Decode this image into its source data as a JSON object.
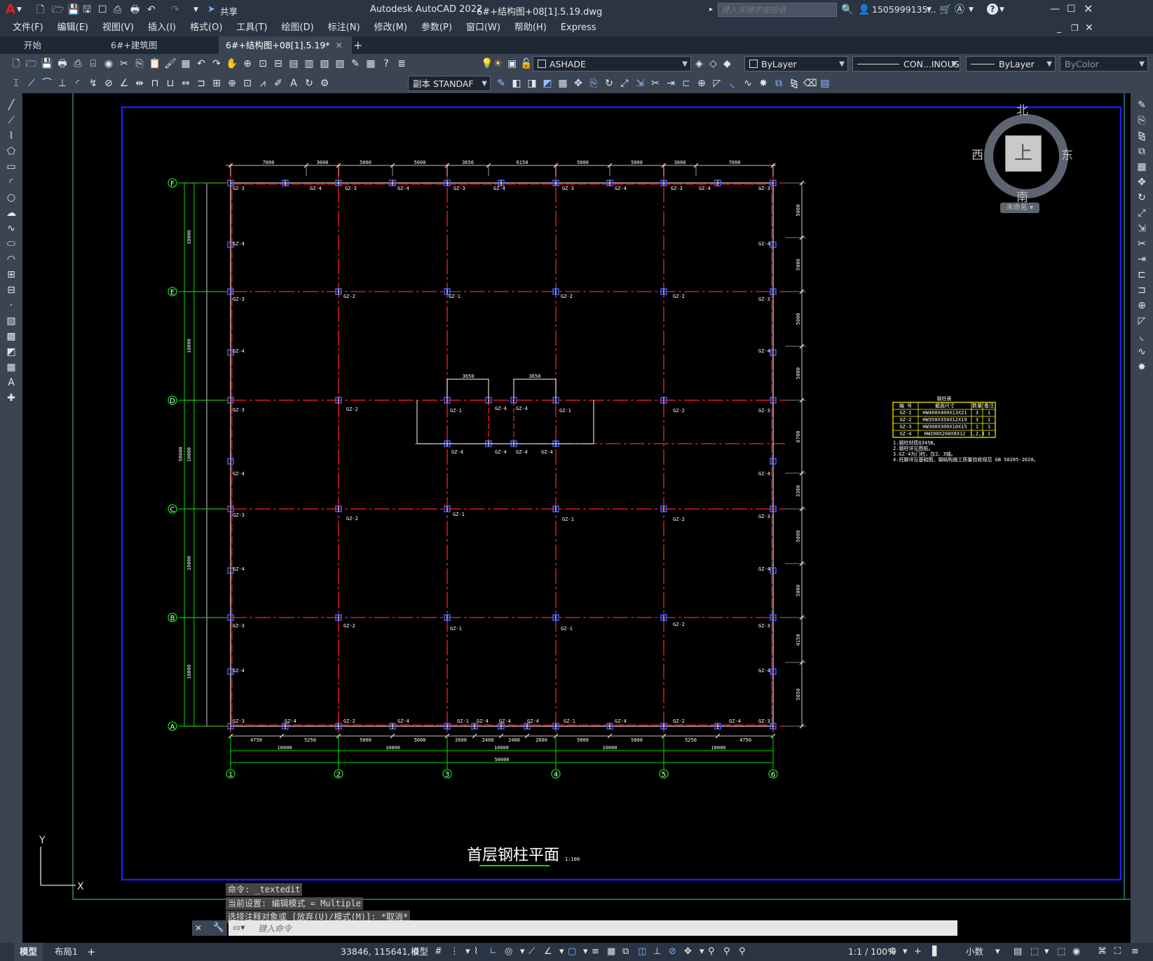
{
  "titlebar": {
    "logo": "A",
    "share_label": "共享",
    "app_title": "Autodesk AutoCAD 2022",
    "file_title": "6#+结构图+08[1].5.19.dwg",
    "search_placeholder": "键入关键字或短语",
    "user_label": "1505999135...",
    "help_label": "?"
  },
  "menu": [
    "文件(F)",
    "编辑(E)",
    "视图(V)",
    "插入(I)",
    "格式(O)",
    "工具(T)",
    "绘图(D)",
    "标注(N)",
    "修改(M)",
    "参数(P)",
    "窗口(W)",
    "帮助(H)",
    "Express"
  ],
  "tabs": [
    {
      "label": "开始"
    },
    {
      "label": "6#+建筑图+08[1].5.16"
    },
    {
      "label": "6#+结构图+08[1].5.19*"
    }
  ],
  "toolbar": {
    "layer_name": "ASHADE",
    "color": "ByLayer",
    "linetype": "CON...INOUS",
    "lineweight": "ByLayer",
    "plotstyle": "ByColor",
    "textstyle": "副本 STANDAF"
  },
  "viewcube": {
    "north": "北",
    "south": "南",
    "east": "东",
    "west": "西",
    "face": "上",
    "wcs": "未命名"
  },
  "drawing": {
    "title": "首层钢柱平面",
    "title_scale": "1:100",
    "row_labels": [
      "F",
      "E",
      "D",
      "C",
      "B",
      "A"
    ],
    "col_labels": [
      "1",
      "2",
      "3",
      "4",
      "5",
      "6"
    ],
    "top_dims": [
      "7000",
      "3000",
      "5000",
      "5000",
      "3650",
      "6150",
      "5000",
      "5000",
      "3000",
      "7000"
    ],
    "inner_dims": [
      "3650",
      "3650"
    ],
    "bottom_dims": [
      "4750",
      "5250",
      "5000",
      "5000",
      "2600",
      "2400",
      "2400",
      "2600",
      "5000",
      "5000",
      "5250",
      "4750"
    ],
    "bottom_bays": [
      "10000",
      "10000",
      "10000",
      "10000",
      "10000"
    ],
    "bottom_total": "50000",
    "left_bays": [
      "10000",
      "10000",
      "10000",
      "10000",
      "10000"
    ],
    "left_total": "50000",
    "right_dims": [
      "5000",
      "5000",
      "5000",
      "5000",
      "6700",
      "3300",
      "5000",
      "5000",
      "4150",
      "5850"
    ],
    "column_labels": [
      "GZ-1",
      "GZ-2",
      "GZ-3",
      "GZ-4"
    ]
  },
  "legend_table": {
    "title": "钢柱表",
    "headers": [
      "编 号",
      "截面尺寸",
      "数量",
      "备注"
    ],
    "rows": [
      [
        "GZ-1",
        "HW400X400X13X21",
        "3",
        "1"
      ],
      [
        "GZ-2",
        "HW350X350X12X19",
        "3",
        "1"
      ],
      [
        "GZ-3",
        "HW300X300X10X15",
        "1",
        "1"
      ],
      [
        "GZ-4",
        "HW200X200X8X12",
        "1,2,3",
        "1"
      ]
    ],
    "notes": [
      "1.钢柱材质Q345B。",
      "2.钢柱详见图纸。",
      "3.GZ-4为门柱，仅2、3轴。",
      "4.柱脚详见基础图，钢结构施工质量验收规范 GB 50205-2020。"
    ]
  },
  "command": {
    "history": [
      "命令: _textedit",
      "当前设置: 编辑模式 = Multiple",
      "选择注释对象或 [放弃(U)/模式(M)]: *取消*"
    ],
    "placeholder": "键入命令"
  },
  "ucs": {
    "x": "X",
    "y": "Y"
  },
  "status": {
    "tab_model": "模型",
    "tab_layout": "布局1",
    "coords": "33846, 115641, 0",
    "mode": "模型",
    "scale": "1:1 / 100%",
    "units": "小数"
  },
  "colors": {
    "frame_blue": "#1c1cff",
    "grid_red": "#ff2020",
    "wall_white": "#ffffff",
    "dim_green": "#00e000",
    "legend_yellow": "#ffff00",
    "chrome": "#2b3442",
    "toolbar": "#3b4453"
  }
}
